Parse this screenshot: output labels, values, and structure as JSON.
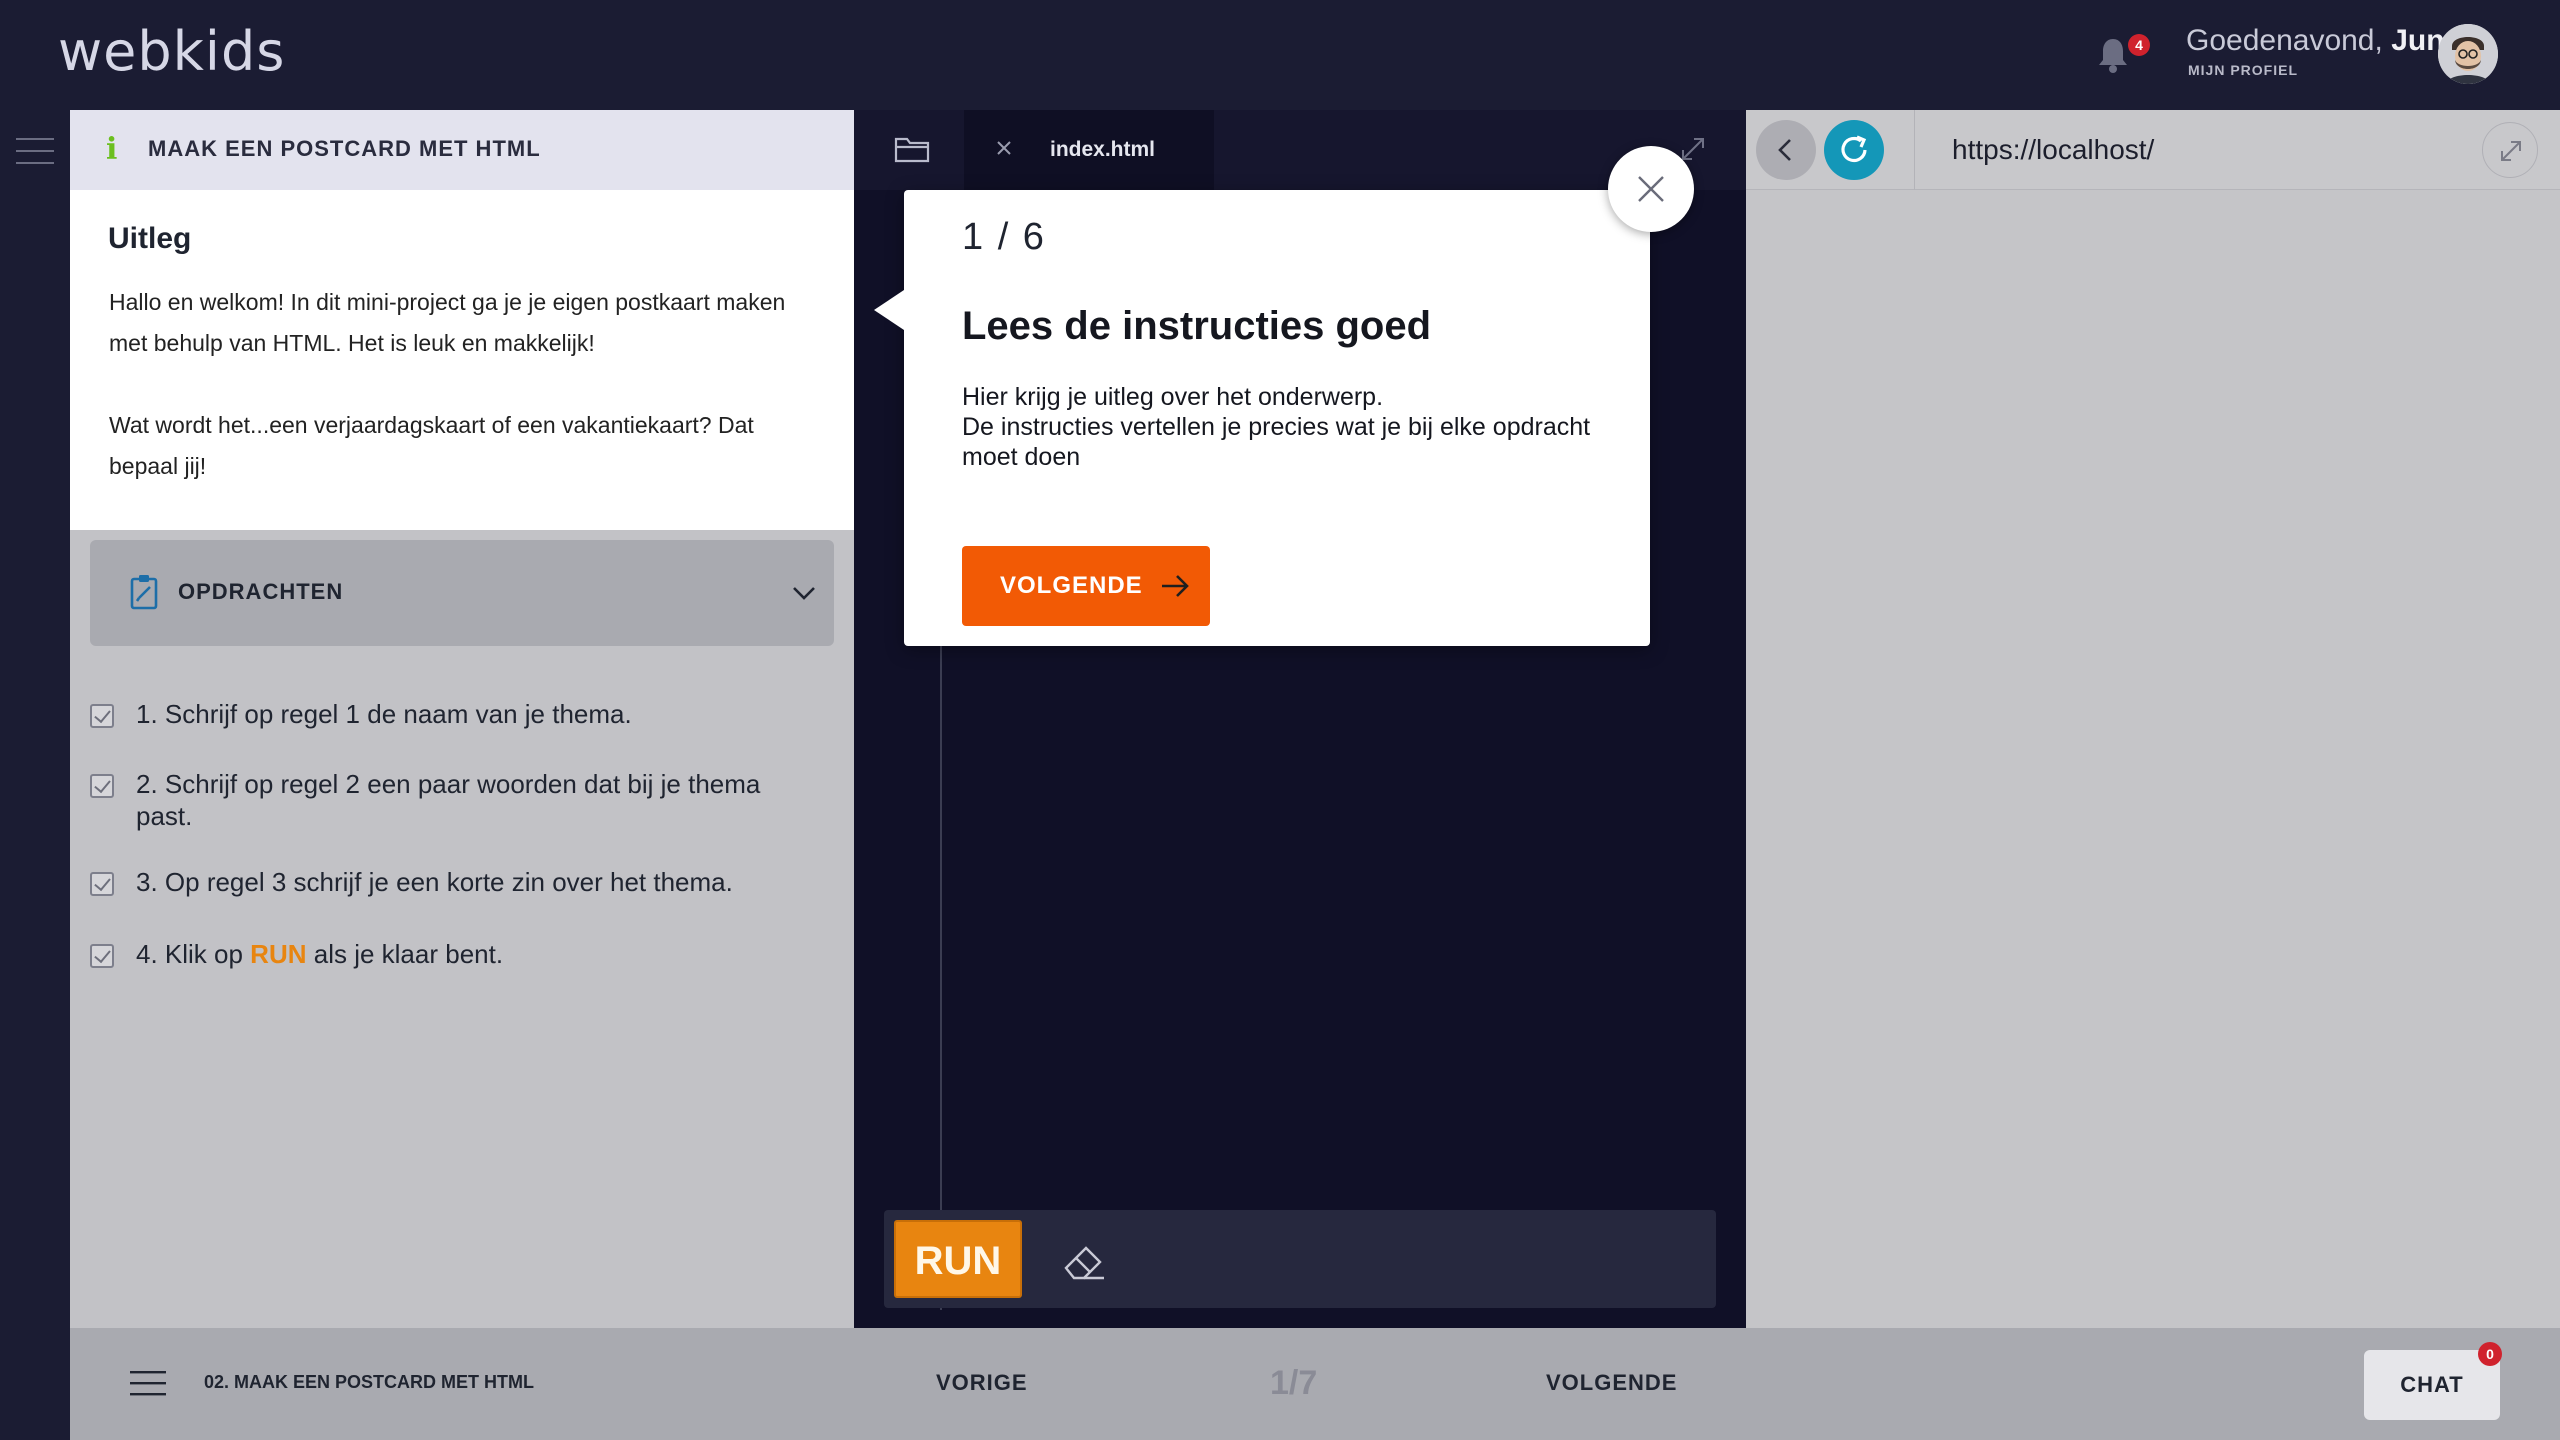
{
  "header": {
    "logo": "webkids",
    "notification_count": "4",
    "greeting_prefix": "Goedenavond,",
    "user_name": "Jun",
    "profile_link": "MIJN PROFIEL"
  },
  "lesson": {
    "title": "MAAK EEN POSTCARD MET HTML",
    "intro_heading": "Uitleg",
    "intro_paragraph_1": "Hallo en welkom! In dit mini-project ga je je eigen postkaart maken met behulp van HTML. Het is leuk en makkelijk!",
    "intro_paragraph_2": "Wat wordt het...een verjaardagskaart of een vakantiekaart? Dat bepaal jij!",
    "tasks_heading": "OPDRACHTEN",
    "tasks": [
      {
        "text": "1. Schrijf op regel 1 de naam van je thema.",
        "checked": true
      },
      {
        "text": "2. Schrijf op regel 2 een paar woorden dat bij je thema past.",
        "checked": true
      },
      {
        "text": "3. Op regel 3 schrijf je een korte zin over het thema.",
        "checked": true
      },
      {
        "text_before": "4. Klik op ",
        "highlight": "RUN",
        "text_after": " als je klaar bent.",
        "checked": true
      }
    ]
  },
  "editor": {
    "tab_name": "index.html",
    "run_label": "RUN"
  },
  "preview": {
    "url": "https://localhost/"
  },
  "footer": {
    "lesson_label": "02. MAAK EEN POSTCARD MET HTML",
    "prev_label": "VORIGE",
    "page_indicator": "1/7",
    "next_label": "VOLGENDE",
    "chat_label": "CHAT",
    "chat_count": "0"
  },
  "tour": {
    "step": "1 / 6",
    "title": "Lees de instructies goed",
    "body_line_1": "Hier krijg je uitleg over het onderwerp.",
    "body_line_2": "De instructies vertellen je precies wat je bij elke opdracht moet doen",
    "next_label": "VOLGENDE"
  },
  "colors": {
    "accent_orange": "#f25a05",
    "run_orange": "#e88510",
    "reload_blue": "#1497b8",
    "info_green": "#6cbf1f"
  }
}
